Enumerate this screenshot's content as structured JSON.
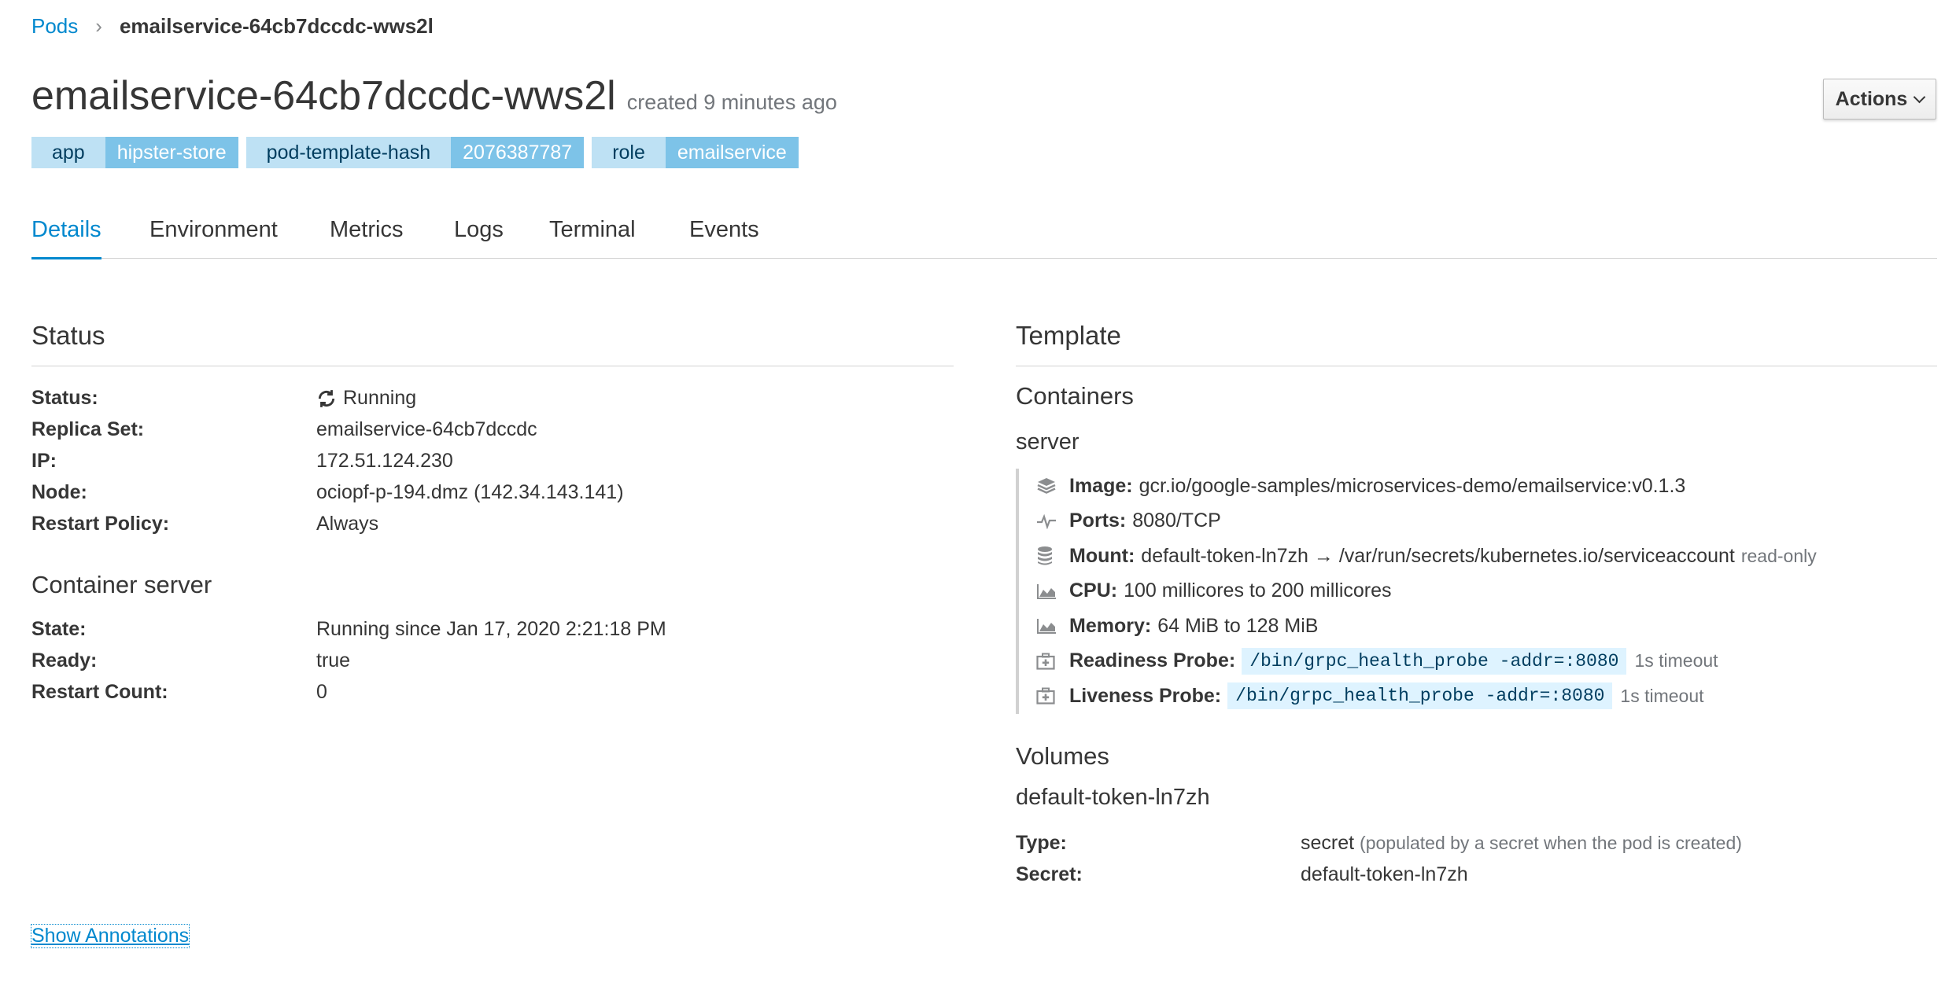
{
  "breadcrumb": {
    "root": "Pods",
    "separator": "›",
    "current": "emailservice-64cb7dccdc-wws2l"
  },
  "header": {
    "title": "emailservice-64cb7dccdc-wws2l",
    "created": "created 9 minutes ago",
    "actions_label": "Actions"
  },
  "labels": [
    {
      "key": "app",
      "value": "hipster-store"
    },
    {
      "key": "pod-template-hash",
      "value": "2076387787"
    },
    {
      "key": "role",
      "value": "emailservice"
    }
  ],
  "tabs": [
    "Details",
    "Environment",
    "Metrics",
    "Logs",
    "Terminal",
    "Events"
  ],
  "status_section": {
    "title": "Status",
    "rows": [
      {
        "key": "Status:",
        "value": "Running"
      },
      {
        "key": "Replica Set:",
        "value": "emailservice-64cb7dccdc"
      },
      {
        "key": "IP:",
        "value": "172.51.124.230"
      },
      {
        "key": "Node:",
        "value": "ociopf-p-194.dmz (142.34.143.141)"
      },
      {
        "key": "Restart Policy:",
        "value": "Always"
      }
    ]
  },
  "container_section": {
    "title": "Container server",
    "rows": [
      {
        "key": "State:",
        "value": "Running since Jan 17, 2020 2:21:18 PM"
      },
      {
        "key": "Ready:",
        "value": "true"
      },
      {
        "key": "Restart Count:",
        "value": "0"
      }
    ]
  },
  "template": {
    "title": "Template",
    "containers_title": "Containers",
    "container_name": "server",
    "image_key": "Image:",
    "image_value": "gcr.io/google-samples/microservices-demo/emailservice:v0.1.3",
    "ports_key": "Ports:",
    "ports_value": "8080/TCP",
    "mount_key": "Mount:",
    "mount_value": "default-token-ln7zh → /var/run/secrets/kubernetes.io/serviceaccount",
    "mount_note": "read-only",
    "cpu_key": "CPU:",
    "cpu_value": "100 millicores to 200 millicores",
    "memory_key": "Memory:",
    "memory_value": "64 MiB to 128 MiB",
    "readiness_key": "Readiness Probe:",
    "readiness_cmd": "/bin/grpc_health_probe -addr=:8080",
    "readiness_timeout": "1s timeout",
    "liveness_key": "Liveness Probe:",
    "liveness_cmd": "/bin/grpc_health_probe -addr=:8080",
    "liveness_timeout": "1s timeout",
    "volumes_title": "Volumes",
    "volume_name": "default-token-ln7zh",
    "type_key": "Type:",
    "type_value": "secret",
    "type_note": "(populated by a secret when the pod is created)",
    "secret_key": "Secret:",
    "secret_value": "default-token-ln7zh"
  },
  "show_annotations": "Show Annotations",
  "colors": {
    "link": "#0088ce",
    "label_key_bg": "#bee1f4",
    "label_value_bg": "#7dc3e8",
    "code_bg": "#def3ff"
  }
}
